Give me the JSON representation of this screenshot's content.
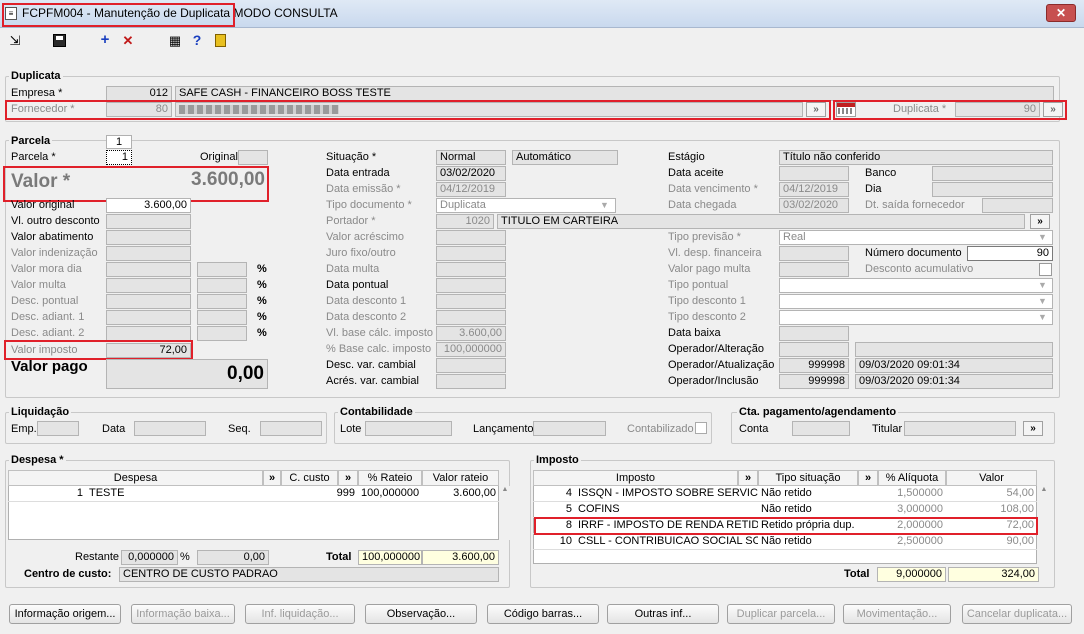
{
  "window": {
    "title": "FCPFM004 - Manutenção de Duplicata",
    "mode": "MODO CONSULTA",
    "close": "✕"
  },
  "toolbar": {
    "export_icon": "⇲",
    "save_icon": "💾",
    "add_icon": "+",
    "delete_icon": "✕",
    "calc_icon": "▦",
    "help_icon": "?",
    "exit_icon": "🚪"
  },
  "duplicata": {
    "legend": "Duplicata",
    "empresa_label": "Empresa *",
    "empresa_code": "012",
    "empresa_name": "SAFE CASH - FINANCEIRO BOSS TESTE",
    "fornecedor_label": "Fornecedor *",
    "fornecedor_code": "80",
    "fornecedor_name": "",
    "duplicata_label": "Duplicata *",
    "duplicata_value": "90"
  },
  "parcela": {
    "tab_label": "Parcela",
    "tab_value": "1",
    "parcela_label": "Parcela *",
    "parcela_value": "1",
    "original_label": "Original",
    "valor_label": "Valor *",
    "valor_value": "3.600,00",
    "rows": [
      {
        "label": "Valor original",
        "value": "3.600,00",
        "pct": false,
        "disabled": false
      },
      {
        "label": "Vl. outro desconto",
        "value": "",
        "pct": false,
        "disabled": false
      },
      {
        "label": "Valor abatimento",
        "value": "",
        "pct": false,
        "disabled": false
      },
      {
        "label": "Valor indenização",
        "value": "",
        "pct": false,
        "disabled": true
      },
      {
        "label": "Valor mora dia",
        "value": "",
        "pct": true,
        "disabled": true
      },
      {
        "label": "Valor multa",
        "value": "",
        "pct": true,
        "disabled": true
      },
      {
        "label": "Desc. pontual",
        "value": "",
        "pct": true,
        "disabled": true
      },
      {
        "label": "Desc. adiant. 1",
        "value": "",
        "pct": true,
        "disabled": true
      },
      {
        "label": "Desc. adiant. 2",
        "value": "",
        "pct": true,
        "disabled": true
      }
    ],
    "pct_symbol": "%",
    "valor_imposto_label": "Valor imposto",
    "valor_imposto_value": "72,00",
    "valor_pago_label": "Valor pago",
    "valor_pago_value": "0,00"
  },
  "middle": {
    "situacao_label": "Situação *",
    "situacao_value": "Normal",
    "situacao_tipo": "Automático",
    "data_entrada_label": "Data entrada",
    "data_entrada_value": "03/02/2020",
    "data_emissao_label": "Data emissão *",
    "data_emissao_value": "04/12/2019",
    "tipo_doc_label": "Tipo documento *",
    "tipo_doc_value": "Duplicata",
    "portador_label": "Portador *",
    "portador_code": "1020",
    "portador_name": "TITULO EM CARTEIRA",
    "valor_acrescimo_label": "Valor acréscimo",
    "juro_label": "Juro fixo/outro",
    "data_multa_label": "Data multa",
    "data_pontual_label": "Data pontual",
    "data_desc1_label": "Data desconto 1",
    "data_desc2_label": "Data desconto 2",
    "vl_base_label": "Vl. base cálc. imposto",
    "vl_base_value": "3.600,00",
    "pct_base_label": "% Base calc. imposto",
    "pct_base_value": "100,000000",
    "desc_var_label": "Desc. var. cambial",
    "acres_var_label": "Acrés. var. cambial"
  },
  "right": {
    "estagio_label": "Estágio",
    "estagio_value": "Título não conferido",
    "data_aceite_label": "Data aceite",
    "banco_label": "Banco",
    "dia_label": "Dia",
    "data_venc_label": "Data vencimento *",
    "data_venc_value": "04/12/2019",
    "data_chegada_label": "Data chegada",
    "data_chegada_value": "03/02/2020",
    "dt_saida_label": "Dt. saída fornecedor",
    "tipo_previsao_label": "Tipo previsão *",
    "tipo_previsao_value": "Real",
    "vl_desp_label": "Vl. desp. financeira",
    "numero_doc_label": "Número documento",
    "numero_doc_value": "90",
    "vl_pago_multa_label": "Valor pago multa",
    "desc_acum_label": "Desconto acumulativo",
    "tipo_pontual_label": "Tipo pontual",
    "tipo_desc1_label": "Tipo desconto 1",
    "tipo_desc2_label": "Tipo desconto 2",
    "data_baixa_label": "Data baixa",
    "op_alt_label": "Operador/Alteração",
    "op_atu_label": "Operador/Atualização",
    "op_atu_code": "999998",
    "op_atu_date": "09/03/2020 09:01:34",
    "op_inc_label": "Operador/Inclusão",
    "op_inc_code": "999998",
    "op_inc_date": "09/03/2020 09:01:34"
  },
  "liquidacao": {
    "legend": "Liquidação",
    "emp_label": "Emp.",
    "data_label": "Data",
    "seq_label": "Seq."
  },
  "contabilidade": {
    "legend": "Contabilidade",
    "lote_label": "Lote",
    "lanc_label": "Lançamento",
    "contab_label": "Contabilizado"
  },
  "cta": {
    "legend": "Cta. pagamento/agendamento",
    "conta_label": "Conta",
    "titular_label": "Titular"
  },
  "despesa": {
    "legend": "Despesa *",
    "headers": [
      "Despesa",
      "C. custo",
      "% Rateio",
      "Valor rateio"
    ],
    "rows": [
      {
        "code": "1",
        "name": "TESTE",
        "ccusto": "999",
        "rateio": "100,000000",
        "valor": "3.600,00"
      }
    ],
    "restante_label": "Restante",
    "restante_pct": "0,000000",
    "restante_valor": "0,00",
    "total_label": "Total",
    "total_pct": "100,000000",
    "total_valor": "3.600,00",
    "centro_label": "Centro de custo:",
    "centro_value": "CENTRO DE CUSTO PADRAO"
  },
  "imposto": {
    "legend": "Imposto",
    "headers": [
      "Imposto",
      "Tipo situação",
      "% Alíquota",
      "Valor"
    ],
    "rows": [
      {
        "code": "4",
        "name": "ISSQN - IMPOSTO SOBRE SERVICO D",
        "tipo": "Não retido",
        "aliq": "1,500000",
        "valor": "54,00"
      },
      {
        "code": "5",
        "name": "COFINS",
        "tipo": "Não retido",
        "aliq": "3,000000",
        "valor": "108,00"
      },
      {
        "code": "8",
        "name": "IRRF - IMPOSTO DE RENDA RETIDO N",
        "tipo": "Retido própria dup.",
        "aliq": "2,000000",
        "valor": "72,00"
      },
      {
        "code": "10",
        "name": "CSLL - CONTRIBUICAO SOCIAL SOB",
        "tipo": "Não retido",
        "aliq": "2,500000",
        "valor": "90,00"
      }
    ],
    "total_label": "Total",
    "total_aliq": "9,000000",
    "total_valor": "324,00"
  },
  "buttons": [
    {
      "label": "Informação origem...",
      "enabled": true
    },
    {
      "label": "Informação baixa...",
      "enabled": false
    },
    {
      "label": "Inf. liquidação...",
      "enabled": false
    },
    {
      "label": "Observação...",
      "enabled": true
    },
    {
      "label": "Código barras...",
      "enabled": true
    },
    {
      "label": "Outras inf...",
      "enabled": true
    },
    {
      "label": "Duplicar parcela...",
      "enabled": false
    },
    {
      "label": "Movimentação...",
      "enabled": false
    },
    {
      "label": "Cancelar duplicata...",
      "enabled": false
    }
  ],
  "colors": {
    "highlight": "#e0202a",
    "disabled_text": "#8a8a8a"
  }
}
